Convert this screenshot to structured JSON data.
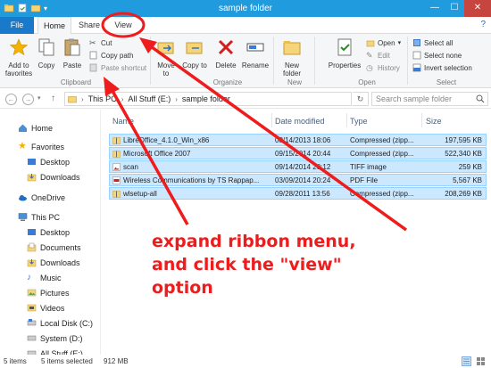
{
  "window": {
    "title": "sample folder",
    "minimize_glyph": "—",
    "maximize_glyph": "☐",
    "close_glyph": "✕"
  },
  "tabs": {
    "file": "File",
    "home": "Home",
    "share": "Share",
    "view": "View",
    "help_glyph": "?"
  },
  "ribbon": {
    "add_to_favorites": "Add to favorites",
    "copy": "Copy",
    "paste": "Paste",
    "cut": "Cut",
    "copy_path": "Copy path",
    "paste_shortcut": "Paste shortcut",
    "clipboard_group": "Clipboard",
    "move_to": "Move to",
    "copy_to": "Copy to",
    "delete": "Delete",
    "rename": "Rename",
    "organize_group": "Organize",
    "new_folder": "New folder",
    "new_group": "New",
    "properties": "Properties",
    "open": "Open",
    "edit": "Edit",
    "history": "History",
    "open_group": "Open",
    "select_all": "Select all",
    "select_none": "Select none",
    "invert_selection": "Invert selection",
    "select_group": "Select"
  },
  "address": {
    "back_glyph": "←",
    "forward_glyph": "→",
    "up_glyph": "↑",
    "crumbs": [
      "This PC",
      "All Stuff (E:)",
      "sample folder"
    ],
    "crumb_sep": "›",
    "refresh_glyph": "↻",
    "search_placeholder": "Search sample folder"
  },
  "nav": {
    "items": [
      "Home",
      "Favorites",
      "Desktop",
      "Downloads",
      "OneDrive",
      "This PC",
      "Desktop",
      "Documents",
      "Downloads",
      "Music",
      "Pictures",
      "Videos",
      "Local Disk (C:)",
      "System (D:)",
      "All Stuff (E:)"
    ]
  },
  "files": {
    "columns": [
      "Name",
      "Date modified",
      "Type",
      "Size"
    ],
    "rows": [
      {
        "name": "LibreOffice_4.1.0_Win_x86",
        "date": "08/14/2013 18:06",
        "type": "Compressed (zipp...",
        "size": "197,595 KB",
        "icon": "zip-folder-icon"
      },
      {
        "name": "Microsoft Office 2007",
        "date": "09/15/2014 20:44",
        "type": "Compressed (zipp...",
        "size": "522,340 KB",
        "icon": "zip-folder-icon"
      },
      {
        "name": "scan",
        "date": "09/14/2014 20:12",
        "type": "TIFF image",
        "size": "259 KB",
        "icon": "image-file-icon"
      },
      {
        "name": "Wireless Communications by TS Rappap...",
        "date": "03/09/2014 20:24",
        "type": "PDF File",
        "size": "5,567 KB",
        "icon": "pdf-file-icon"
      },
      {
        "name": "wlsetup-all",
        "date": "09/28/2011 13:56",
        "type": "Compressed (zipp...",
        "size": "208,269 KB",
        "icon": "zip-folder-icon"
      }
    ]
  },
  "status": {
    "items_count": "5 items",
    "selected": "5 items selected",
    "size": "912 MB"
  },
  "annotation": {
    "text": "expand ribbon menu, and click the \"view\" option",
    "color": "#ee1c1c"
  }
}
